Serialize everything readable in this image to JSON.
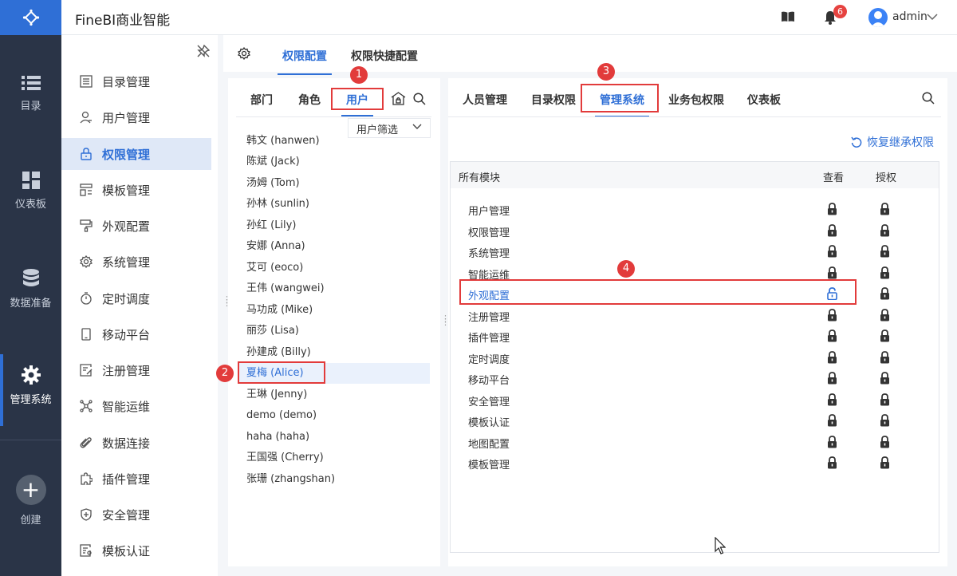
{
  "app": {
    "title": "FineBI商业智能",
    "notifications": "6",
    "user": "admin"
  },
  "leftnav": [
    {
      "label": "目录",
      "icon": "list-icon"
    },
    {
      "label": "仪表板",
      "icon": "dashboard-icon"
    },
    {
      "label": "数据准备",
      "icon": "database-icon"
    },
    {
      "label": "管理系统",
      "icon": "gear-icon"
    },
    {
      "label": "创建",
      "icon": "plus-icon"
    }
  ],
  "sidebar": [
    {
      "label": "目录管理"
    },
    {
      "label": "用户管理"
    },
    {
      "label": "权限管理"
    },
    {
      "label": "模板管理"
    },
    {
      "label": "外观配置"
    },
    {
      "label": "系统管理"
    },
    {
      "label": "定时调度"
    },
    {
      "label": "移动平台"
    },
    {
      "label": "注册管理"
    },
    {
      "label": "智能运维"
    },
    {
      "label": "数据连接"
    },
    {
      "label": "插件管理"
    },
    {
      "label": "安全管理"
    },
    {
      "label": "模板认证"
    }
  ],
  "content_tabs": [
    "权限配置",
    "权限快捷配置"
  ],
  "user_tabs": [
    "部门",
    "角色",
    "用户"
  ],
  "user_filter": "用户筛选",
  "users": [
    "韩文 (hanwen)",
    "陈斌 (Jack)",
    "汤姆 (Tom)",
    "孙林 (sunlin)",
    "孙红 (Lily)",
    "安娜 (Anna)",
    "艾可 (eoco)",
    "王伟 (wangwei)",
    "马功成 (Mike)",
    "丽莎 (Lisa)",
    "孙建成 (Billy)",
    "夏梅 (Alice)",
    "王琳 (Jenny)",
    "demo (demo)",
    "haha (haha)",
    "王国强 (Cherry)",
    "张珊 (zhangshan)"
  ],
  "perm_tabs": [
    "人员管理",
    "目录权限",
    "管理系统",
    "业务包权限",
    "仪表板"
  ],
  "restore_label": "恢复继承权限",
  "table": {
    "col_module": "所有模块",
    "col_view": "查看",
    "col_auth": "授权",
    "rows": [
      "用户管理",
      "权限管理",
      "系统管理",
      "智能运维",
      "外观配置",
      "注册管理",
      "插件管理",
      "定时调度",
      "移动平台",
      "安全管理",
      "模板认证",
      "地图配置",
      "模板管理"
    ]
  },
  "markers": [
    "1",
    "2",
    "3",
    "4"
  ],
  "colors": {
    "accent": "#2f6fd6",
    "nav_bg": "#2a3447",
    "annotation_red": "#e23b3b"
  }
}
